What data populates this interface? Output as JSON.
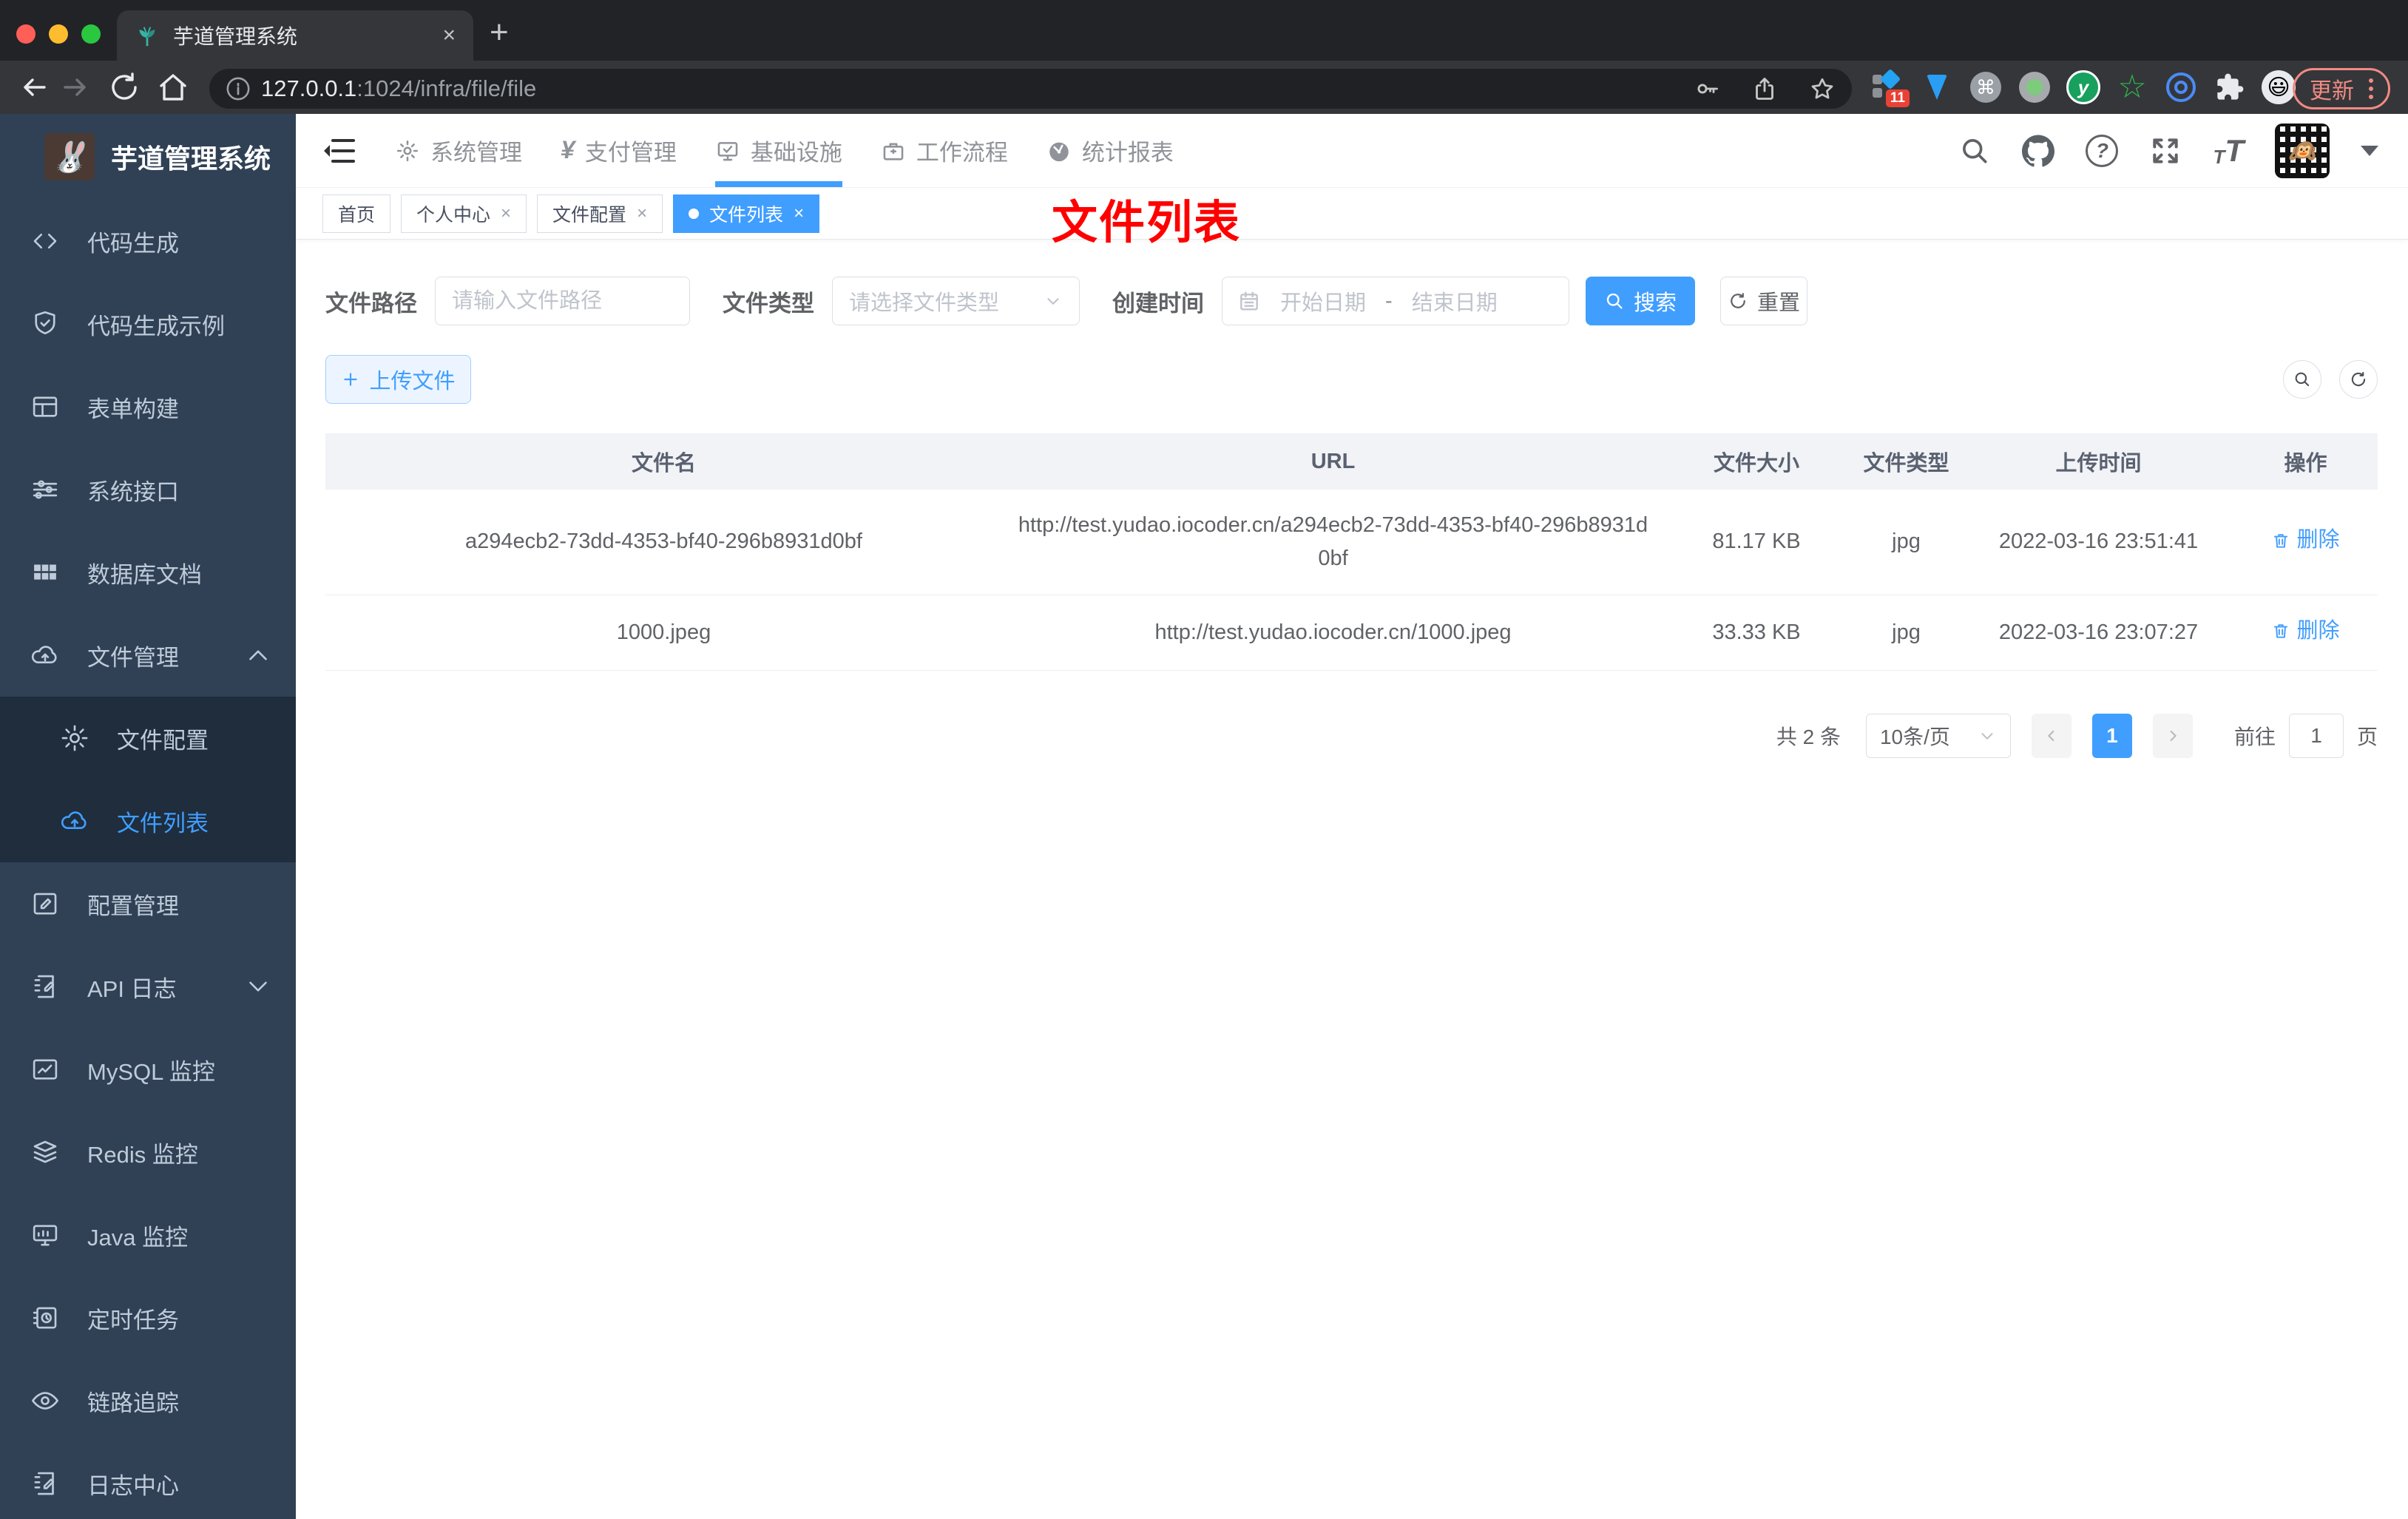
{
  "browser": {
    "tab_title": "芋道管理系统",
    "close_glyph": "×",
    "new_tab_glyph": "+",
    "url_host": "127.0.0.1",
    "url_rest": ":1024/infra/file/file",
    "ext_badge": "11",
    "update_label": "更新"
  },
  "sidebar": {
    "logo_title": "芋道管理系统",
    "items": [
      {
        "label": "代码生成"
      },
      {
        "label": "代码生成示例"
      },
      {
        "label": "表单构建"
      },
      {
        "label": "系统接口"
      },
      {
        "label": "数据库文档"
      },
      {
        "label": "文件管理"
      },
      {
        "label": "配置管理"
      },
      {
        "label": "API 日志"
      },
      {
        "label": "MySQL 监控"
      },
      {
        "label": "Redis 监控"
      },
      {
        "label": "Java 监控"
      },
      {
        "label": "定时任务"
      },
      {
        "label": "链路追踪"
      },
      {
        "label": "日志中心"
      }
    ],
    "submenu": [
      {
        "label": "文件配置"
      },
      {
        "label": "文件列表"
      }
    ]
  },
  "header": {
    "menus": [
      {
        "label": "系统管理"
      },
      {
        "label": "支付管理"
      },
      {
        "label": "基础设施"
      },
      {
        "label": "工作流程"
      },
      {
        "label": "统计报表"
      }
    ]
  },
  "tags": {
    "items": [
      {
        "label": "首页"
      },
      {
        "label": "个人中心"
      },
      {
        "label": "文件配置"
      },
      {
        "label": "文件列表"
      }
    ]
  },
  "annotation": "文件列表",
  "filters": {
    "path_label": "文件路径",
    "path_placeholder": "请输入文件路径",
    "type_label": "文件类型",
    "type_placeholder": "请选择文件类型",
    "date_label": "创建时间",
    "start_placeholder": "开始日期",
    "range_separator": "-",
    "end_placeholder": "结束日期",
    "search_label": "搜索",
    "reset_label": "重置"
  },
  "toolbar": {
    "upload_label": "上传文件"
  },
  "table": {
    "columns": [
      "文件名",
      "URL",
      "文件大小",
      "文件类型",
      "上传时间",
      "操作"
    ],
    "rows": [
      {
        "name": "a294ecb2-73dd-4353-bf40-296b8931d0bf",
        "url": "http://test.yudao.iocoder.cn/a294ecb2-73dd-4353-bf40-296b8931d0bf",
        "size": "81.17 KB",
        "type": "jpg",
        "time": "2022-03-16 23:51:41",
        "action": "删除"
      },
      {
        "name": "1000.jpeg",
        "url": "http://test.yudao.iocoder.cn/1000.jpeg",
        "size": "33.33 KB",
        "type": "jpg",
        "time": "2022-03-16 23:07:27",
        "action": "删除"
      }
    ]
  },
  "pagination": {
    "total": "共 2 条",
    "page_size": "10条/页",
    "current_page": "1",
    "goto_label": "前往",
    "goto_value": "1",
    "unit_label": "页"
  },
  "colors": {
    "accent": "#409eff",
    "sidebar_bg": "#304156",
    "submenu_bg": "#1f2d3d",
    "annotation": "#ff0000",
    "update_button": "#f28b82"
  }
}
